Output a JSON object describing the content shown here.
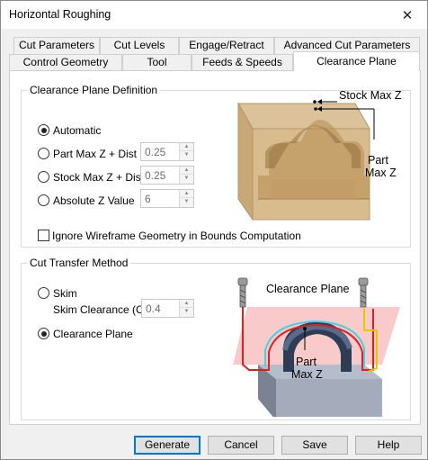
{
  "window": {
    "title": "Horizontal Roughing",
    "close_label": "✕"
  },
  "tabs_row1": [
    {
      "label": "Cut Parameters"
    },
    {
      "label": "Cut Levels"
    },
    {
      "label": "Engage/Retract"
    },
    {
      "label": "Advanced Cut Parameters"
    }
  ],
  "tabs_row2": [
    {
      "label": "Control Geometry"
    },
    {
      "label": "Tool"
    },
    {
      "label": "Feeds & Speeds"
    },
    {
      "label": "Clearance Plane"
    }
  ],
  "active_tab": "Clearance Plane",
  "clearance_def": {
    "legend": "Clearance Plane Definition",
    "options": [
      {
        "label": "Automatic",
        "selected": true
      },
      {
        "label": "Part Max Z + Dist",
        "selected": false,
        "value": "0.25"
      },
      {
        "label": "Stock Max Z + Dist",
        "selected": false,
        "value": "0.25"
      },
      {
        "label": "Absolute Z Value",
        "selected": false,
        "value": "6"
      }
    ],
    "ignore_wireframe": {
      "label": "Ignore Wireframe Geometry in Bounds Computation",
      "checked": false
    },
    "illustration": {
      "stock_max_z": "Stock Max Z",
      "part_max_z_line1": "Part",
      "part_max_z_line2": "Max Z"
    }
  },
  "cut_transfer": {
    "legend": "Cut Transfer Method",
    "skim": {
      "label": "Skim",
      "selected": false
    },
    "skim_clearance": {
      "label": "Skim Clearance (C)",
      "value": "0.4"
    },
    "clearance_plane": {
      "label": "Clearance Plane",
      "selected": true
    },
    "illustration": {
      "plane_label": "Clearance Plane",
      "part_max_z_line1": "Part",
      "part_max_z_line2": "Max Z"
    }
  },
  "buttons": {
    "generate": "Generate",
    "cancel": "Cancel",
    "save": "Save",
    "help": "Help"
  },
  "colors": {
    "accent": "#0078d7",
    "stock": "#c9a675",
    "plane": "#f4b1b1",
    "path_red": "#e02020",
    "path_cyan": "#3fd3e6",
    "path_yellow": "#e6c800"
  }
}
